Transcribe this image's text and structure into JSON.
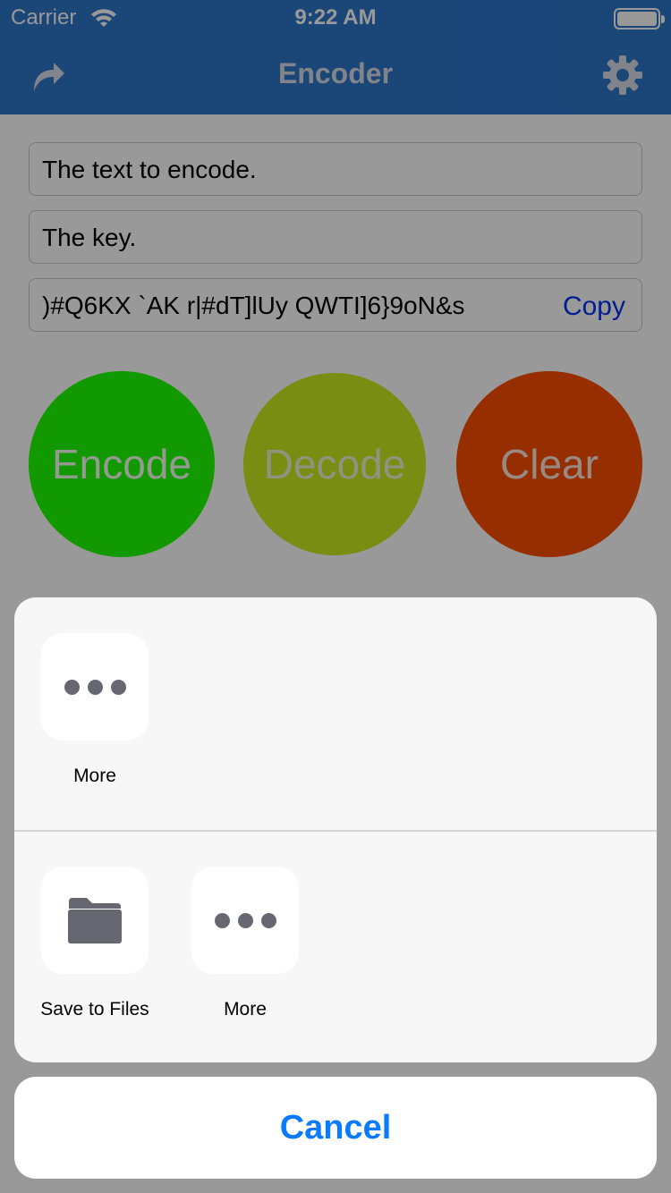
{
  "status_bar": {
    "carrier": "Carrier",
    "time": "9:22 AM"
  },
  "nav": {
    "title": "Encoder",
    "left_icon": "share-icon",
    "right_icon": "gear-icon"
  },
  "fields": {
    "text_to_encode": "The text to encode.",
    "key": "The key.",
    "output": ")#Q6KX `AK r|#dT]lUy QWTI]6}9oN&s",
    "copy_label": "Copy"
  },
  "buttons": {
    "encode": "Encode",
    "decode": "Decode",
    "clear": "Clear"
  },
  "share_sheet": {
    "row1": [
      {
        "label": "More",
        "icon": "more-icon"
      }
    ],
    "row2": [
      {
        "label": "Save to Files",
        "icon": "folder-icon"
      },
      {
        "label": "More",
        "icon": "more-icon"
      }
    ],
    "cancel_label": "Cancel"
  },
  "colors": {
    "nav_bar": "#2e75c9",
    "encode": "#21ff00",
    "decode": "#c8ec1f",
    "clear": "#fb4d00",
    "link": "#0a7aff"
  }
}
